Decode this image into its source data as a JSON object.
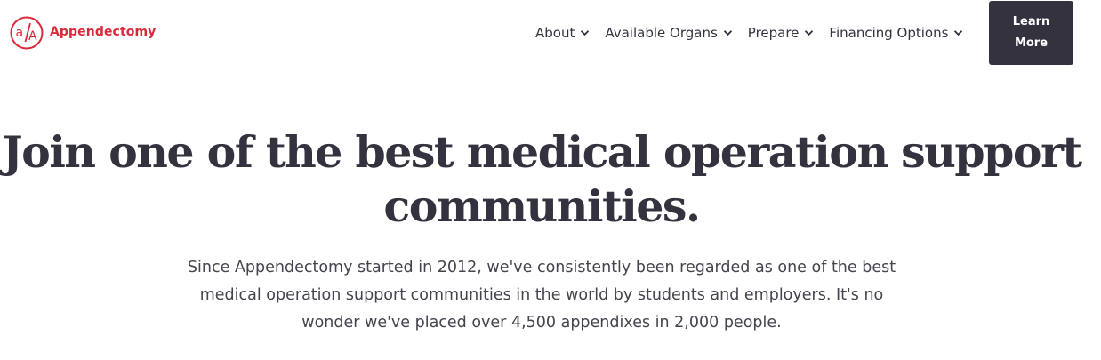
{
  "brand": {
    "name": "Appendectomy",
    "logo_glyph": "a/A",
    "color": "#d92a3b"
  },
  "nav": {
    "items": [
      {
        "label": "About",
        "icon": "chevron-down-icon"
      },
      {
        "label": "Available Organs",
        "icon": "chevron-down-icon"
      },
      {
        "label": "Prepare",
        "icon": "chevron-down-icon"
      },
      {
        "label": "Financing Options",
        "icon": "chevron-down-icon"
      }
    ],
    "cta_label": "Learn More",
    "cta_color": "#33323e"
  },
  "hero": {
    "title": "Join one of the best medical operation support communities.",
    "subtitle": "Since Appendectomy started in 2012, we've consistently been regarded as one of the best medical operation support communities in the world by students and employers. It's no wonder we've placed over 4,500 appendixes in 2,000 people."
  },
  "colors": {
    "text": "#33323e",
    "background": "#ffffff"
  }
}
